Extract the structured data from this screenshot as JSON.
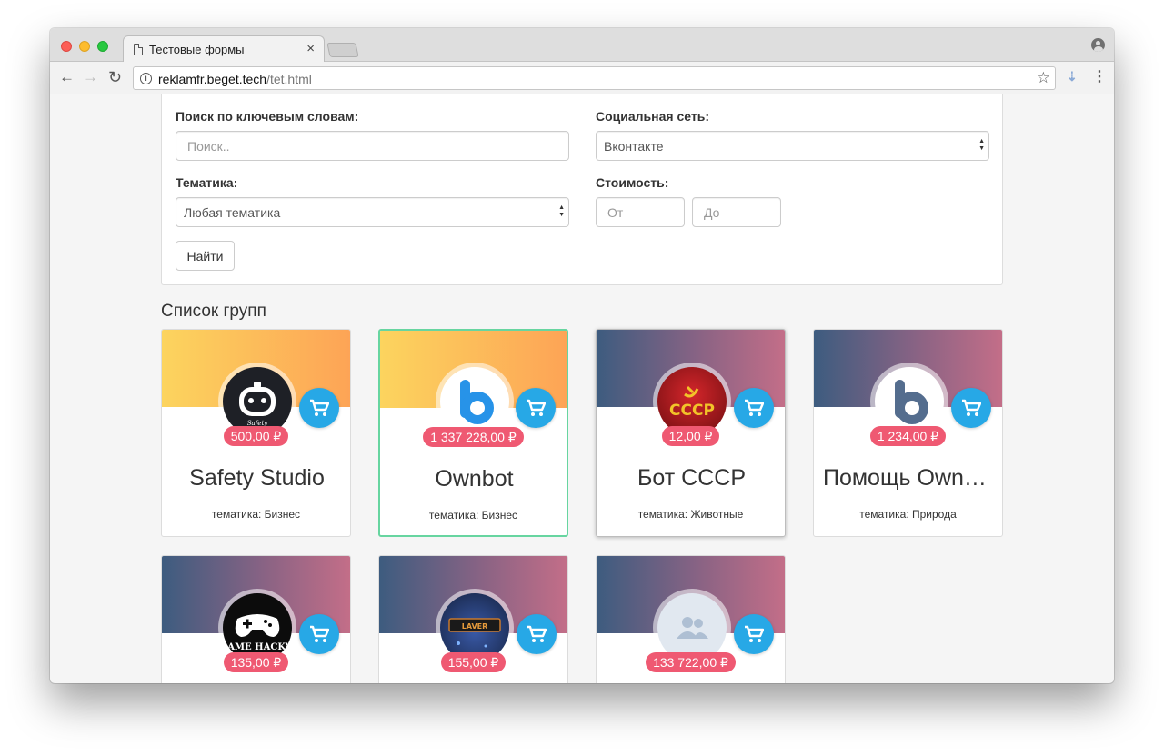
{
  "browser": {
    "tab_title": "Тестовые формы",
    "tab_close": "×",
    "url_host": "reklamfr.beget.tech",
    "url_path": "/tet.html"
  },
  "filters": {
    "keywords_label": "Поиск по ключевым словам:",
    "keywords_placeholder": "Поиск..",
    "social_label": "Социальная сеть:",
    "social_value": "Вконтакте",
    "topic_label": "Тематика:",
    "topic_value": "Любая тематика",
    "price_label": "Стоимость:",
    "price_from_placeholder": "От",
    "price_to_placeholder": "До",
    "find_button": "Найти"
  },
  "list_title": "Список групп",
  "groups": [
    {
      "name": "Safety Studio",
      "price": "500,00 ₽",
      "topic": "тематика: Бизнес",
      "avatar_icon": "safety-studio-logo-icon",
      "banner": "warm"
    },
    {
      "name": "Ownbot",
      "price": "1 337 228,00 ₽",
      "topic": "тематика: Бизнес",
      "avatar_icon": "ownbot-logo-icon",
      "banner": "warm",
      "state": "selected"
    },
    {
      "name": "Бот СССР",
      "price": "12,00 ₽",
      "topic": "тематика: Животные",
      "avatar_icon": "ussr-logo-icon",
      "avatar_text": "СССР",
      "banner": "cool",
      "state": "hovered"
    },
    {
      "name": "Помощь Ownbot",
      "price": "1 234,00 ₽",
      "topic": "тематика: Природа",
      "avatar_icon": "ownbot-logo-icon",
      "banner": "cool"
    },
    {
      "name": "",
      "price": "135,00 ₽",
      "topic": "",
      "avatar_icon": "game-hacks-logo-icon",
      "avatar_text": "GAME HACK'S",
      "banner": "cool"
    },
    {
      "name": "",
      "price": "155,00 ₽",
      "topic": "",
      "avatar_icon": "laver-logo-icon",
      "avatar_text": "LAVER",
      "banner": "cool"
    },
    {
      "name": "",
      "price": "133 722,00 ₽",
      "topic": "",
      "avatar_icon": "users-placeholder-icon",
      "banner": "cool"
    }
  ],
  "colors": {
    "cart_button": "#27a8e6",
    "price_badge": "#ef5972",
    "selected_border": "#67d5a0"
  }
}
